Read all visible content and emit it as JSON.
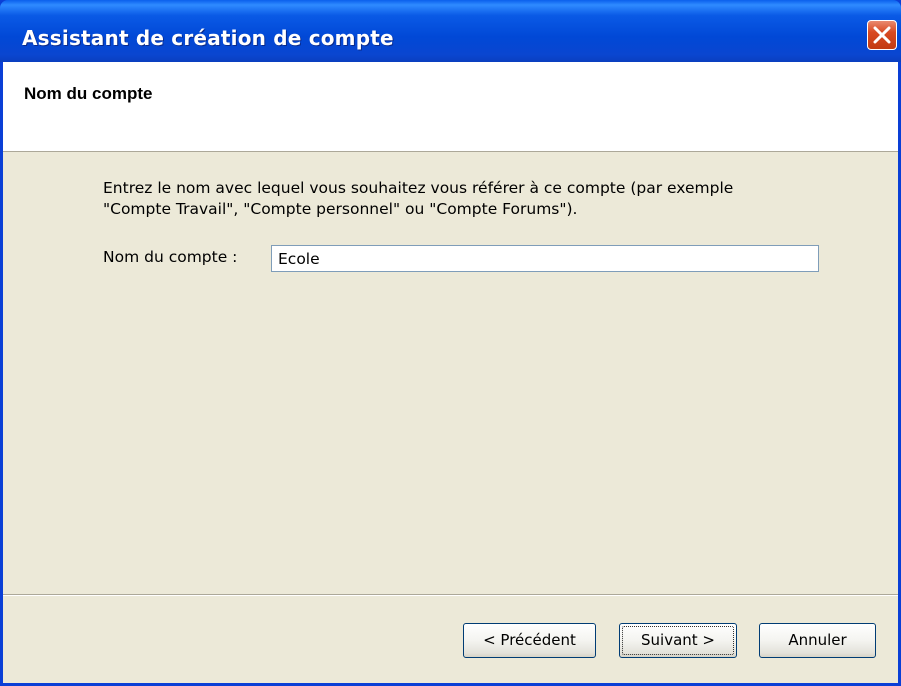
{
  "window": {
    "title": "Assistant de création de compte"
  },
  "header": {
    "title": "Nom du compte"
  },
  "main": {
    "instructions": "Entrez le nom avec lequel vous souhaitez vous référer à ce compte (par exemple\n\"Compte Travail\", \"Compte personnel\" ou \"Compte Forums\").",
    "account_name_label": "Nom du compte :",
    "account_name_value": "Ecole"
  },
  "footer": {
    "back_label": "< Précédent",
    "next_label": "Suivant >",
    "cancel_label": "Annuler"
  },
  "icons": {
    "close": "close-icon"
  },
  "colors": {
    "titlebar": "#0148d6",
    "dialog_background": "#ece9d8",
    "close_button": "#d94a22"
  }
}
